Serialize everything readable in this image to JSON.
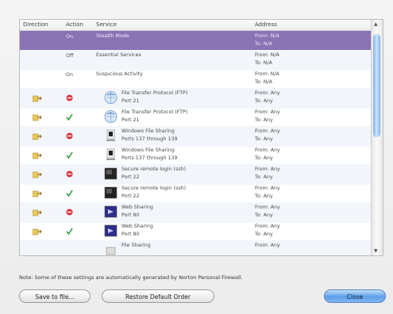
{
  "table": {
    "headers": {
      "direction": "Direction",
      "action": "Action",
      "service": "Service",
      "address": "Address"
    },
    "rows": [
      {
        "direction_icon": "",
        "action_text": "On",
        "action_icon": "",
        "service_icon": "",
        "service": "Stealth Mode",
        "service_sub": "",
        "from": "From: N/A",
        "to": "To:   N/A",
        "selected": true
      },
      {
        "direction_icon": "",
        "action_text": "Off",
        "action_icon": "",
        "service_icon": "",
        "service": "Essential Services",
        "service_sub": "",
        "from": "From: N/A",
        "to": "To:   N/A"
      },
      {
        "direction_icon": "",
        "action_text": "On",
        "action_icon": "",
        "service_icon": "",
        "service": "Suspicious Activity",
        "service_sub": "",
        "from": "From: N/A",
        "to": "To:   N/A"
      },
      {
        "direction_icon": "folder-arrow-icon",
        "action_text": "",
        "action_icon": "block-icon",
        "service_icon": "ftp-globe-icon",
        "service": "File Transfer Protocol (FTP)",
        "service_sub": "Port 21",
        "from": "From: Any",
        "to": "To:   Any"
      },
      {
        "direction_icon": "folder-arrow-icon",
        "action_text": "",
        "action_icon": "allow-check-icon",
        "service_icon": "ftp-globe-icon",
        "service": "File Transfer Protocol (FTP)",
        "service_sub": "Port 21",
        "from": "From: Any",
        "to": "To:   Any"
      },
      {
        "direction_icon": "folder-arrow-icon",
        "action_text": "",
        "action_icon": "block-icon",
        "service_icon": "windows-share-icon",
        "service": "Windows File Sharing",
        "service_sub": "Ports 137 through 139",
        "from": "From: Any",
        "to": "To:   Any"
      },
      {
        "direction_icon": "folder-arrow-icon",
        "action_text": "",
        "action_icon": "allow-check-icon",
        "service_icon": "windows-share-icon",
        "service": "Windows File Sharing",
        "service_sub": "Ports 137 through 139",
        "from": "From: Any",
        "to": "To:   Any"
      },
      {
        "direction_icon": "folder-arrow-icon",
        "action_text": "",
        "action_icon": "block-icon",
        "service_icon": "terminal-icon",
        "service": "Secure remote login (ssh)",
        "service_sub": "Port 22",
        "from": "From: Any",
        "to": "To:   Any"
      },
      {
        "direction_icon": "folder-arrow-icon",
        "action_text": "",
        "action_icon": "allow-check-icon",
        "service_icon": "terminal-icon",
        "service": "Secure remote login (ssh)",
        "service_sub": "Port 22",
        "from": "From: Any",
        "to": "To:   Any"
      },
      {
        "direction_icon": "folder-arrow-icon",
        "action_text": "",
        "action_icon": "block-icon",
        "service_icon": "web-sharing-icon",
        "service": "Web Sharing",
        "service_sub": "Port 80",
        "from": "From: Any",
        "to": "To:   Any"
      },
      {
        "direction_icon": "folder-arrow-icon",
        "action_text": "",
        "action_icon": "allow-check-icon",
        "service_icon": "web-sharing-icon",
        "service": "Web Sharing",
        "service_sub": "Port 80",
        "from": "From: Any",
        "to": "To:   Any"
      },
      {
        "direction_icon": "",
        "action_text": "",
        "action_icon": "",
        "service_icon": "file-sharing-icon",
        "service": "File Sharing",
        "service_sub": "",
        "from": "From: Any",
        "to": ""
      }
    ]
  },
  "note": "Note: Some of these settings are automatically generated by Norton Personal Firewall.",
  "buttons": {
    "save": "Save to file...",
    "restore": "Restore Default Order",
    "close": "Close"
  },
  "colors": {
    "selected_row": "#8a73b5",
    "block": "#d8353a",
    "allow": "#2f9a3a",
    "folder": "#d8b94a"
  }
}
